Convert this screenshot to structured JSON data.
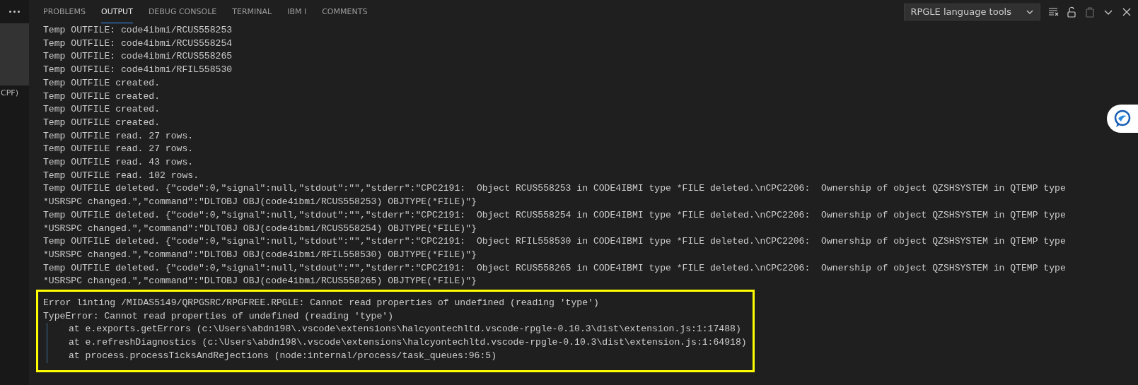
{
  "sidebar": {
    "label": "CPF)"
  },
  "panel": {
    "tabs": [
      {
        "label": "PROBLEMS",
        "selected": false
      },
      {
        "label": "OUTPUT",
        "selected": true
      },
      {
        "label": "DEBUG CONSOLE",
        "selected": false
      },
      {
        "label": "TERMINAL",
        "selected": false
      },
      {
        "label": "IBM I",
        "selected": false
      },
      {
        "label": "COMMENTS",
        "selected": false
      }
    ],
    "channel_dropdown": {
      "value": "RPGLE language tools"
    },
    "toolbar": [
      {
        "kind": "clear",
        "disabled": false
      },
      {
        "kind": "lock",
        "disabled": false
      },
      {
        "kind": "copy",
        "disabled": true
      },
      {
        "kind": "chevron",
        "disabled": false
      },
      {
        "kind": "close",
        "disabled": false
      }
    ]
  },
  "output_lines": [
    "Temp OUTFILE: code4ibmi/RCUS558253",
    "Temp OUTFILE: code4ibmi/RCUS558254",
    "Temp OUTFILE: code4ibmi/RCUS558265",
    "Temp OUTFILE: code4ibmi/RFIL558530",
    "Temp OUTFILE created.",
    "Temp OUTFILE created.",
    "Temp OUTFILE created.",
    "Temp OUTFILE created.",
    "Temp OUTFILE read. 27 rows.",
    "Temp OUTFILE read. 27 rows.",
    "Temp OUTFILE read. 43 rows.",
    "Temp OUTFILE read. 102 rows.",
    "Temp OUTFILE deleted. {\"code\":0,\"signal\":null,\"stdout\":\"\",\"stderr\":\"CPC2191:  Object RCUS558253 in CODE4IBMI type *FILE deleted.\\nCPC2206:  Ownership of object QZSHSYSTEM in QTEMP type *USRSPC changed.\",\"command\":\"DLTOBJ OBJ(code4ibmi/RCUS558253) OBJTYPE(*FILE)\"}",
    "Temp OUTFILE deleted. {\"code\":0,\"signal\":null,\"stdout\":\"\",\"stderr\":\"CPC2191:  Object RCUS558254 in CODE4IBMI type *FILE deleted.\\nCPC2206:  Ownership of object QZSHSYSTEM in QTEMP type *USRSPC changed.\",\"command\":\"DLTOBJ OBJ(code4ibmi/RCUS558254) OBJTYPE(*FILE)\"}",
    "Temp OUTFILE deleted. {\"code\":0,\"signal\":null,\"stdout\":\"\",\"stderr\":\"CPC2191:  Object RFIL558530 in CODE4IBMI type *FILE deleted.\\nCPC2206:  Ownership of object QZSHSYSTEM in QTEMP type *USRSPC changed.\",\"command\":\"DLTOBJ OBJ(code4ibmi/RFIL558530) OBJTYPE(*FILE)\"}",
    "Temp OUTFILE deleted. {\"code\":0,\"signal\":null,\"stdout\":\"\",\"stderr\":\"CPC2191:  Object RCUS558265 in CODE4IBMI type *FILE deleted.\\nCPC2206:  Ownership of object QZSHSYSTEM in QTEMP type *USRSPC changed.\",\"command\":\"DLTOBJ OBJ(code4ibmi/RCUS558265) OBJTYPE(*FILE)\"}"
  ],
  "error_block": {
    "lines": [
      {
        "text": "Error linting /MIDAS5149/QRPGSRC/RPGFREE.RPGLE: Cannot read properties of undefined (reading 'type')",
        "kind": "message"
      },
      {
        "text": "TypeError: Cannot read properties of undefined (reading 'type')",
        "kind": "message"
      },
      {
        "text": "at e.exports.getErrors (c:\\Users\\abdn198\\.vscode\\extensions\\halcyontechltd.vscode-rpgle-0.10.3\\dist\\extension.js:1:17488)",
        "kind": "stack"
      },
      {
        "text": "at e.refreshDiagnostics (c:\\Users\\abdn198\\.vscode\\extensions\\halcyontechltd.vscode-rpgle-0.10.3\\dist\\extension.js:1:64918)",
        "kind": "stack"
      },
      {
        "text": "at process.processTicksAndRejections (node:internal/process/task_queues:96:5)",
        "kind": "stack"
      }
    ]
  }
}
